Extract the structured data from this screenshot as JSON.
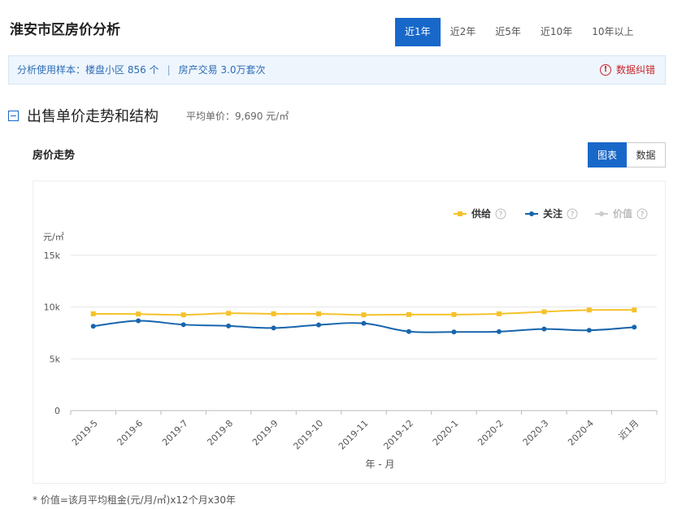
{
  "page": {
    "title": "淮安市区房价分析"
  },
  "period_tabs": [
    {
      "label": "近1年",
      "active": true
    },
    {
      "label": "近2年",
      "active": false
    },
    {
      "label": "近5年",
      "active": false
    },
    {
      "label": "近10年",
      "active": false
    },
    {
      "label": "10年以上",
      "active": false
    }
  ],
  "sample": {
    "prefix": "分析使用样本：",
    "item1": "楼盘小区 856 个",
    "separator": "|",
    "item2": "房产交易 3.0万套次",
    "correction": "数据纠错"
  },
  "section": {
    "title": "出售单价走势和结构",
    "avg_label": "平均单价：",
    "avg_value": "9,690 元/㎡"
  },
  "chart_header": {
    "title": "房价走势",
    "view_chart": "图表",
    "view_data": "数据"
  },
  "footnote": "* 价值=该月平均租金(元/月/㎡)x12个月x30年",
  "chart_data": {
    "type": "line",
    "ylabel": "元/㎡",
    "xlabel": "年 - 月",
    "ylim": [
      0,
      15000
    ],
    "yticks": [
      {
        "value": 0,
        "label": "0"
      },
      {
        "value": 5000,
        "label": "5k"
      },
      {
        "value": 10000,
        "label": "10k"
      },
      {
        "value": 15000,
        "label": "15k"
      }
    ],
    "categories": [
      "2019-5",
      "2019-6",
      "2019-7",
      "2019-8",
      "2019-9",
      "2019-10",
      "2019-11",
      "2019-12",
      "2020-1",
      "2020-2",
      "2020-3",
      "2020-4",
      "近1月"
    ],
    "series": [
      {
        "name": "供给",
        "color": "#f5c22b",
        "marker": "square",
        "values": [
          9350,
          9330,
          9250,
          9400,
          9350,
          9350,
          9250,
          9280,
          9280,
          9350,
          9550,
          9720,
          9720
        ]
      },
      {
        "name": "关注",
        "color": "#1765ad",
        "marker": "circle",
        "values": [
          8150,
          8680,
          8300,
          8180,
          7980,
          8280,
          8430,
          7640,
          7600,
          7630,
          7880,
          7760,
          8060
        ]
      },
      {
        "name": "价值",
        "color": "#cccccc",
        "marker": "circle",
        "disabled": true,
        "values": []
      }
    ],
    "legend": "top-right",
    "grid": true
  }
}
